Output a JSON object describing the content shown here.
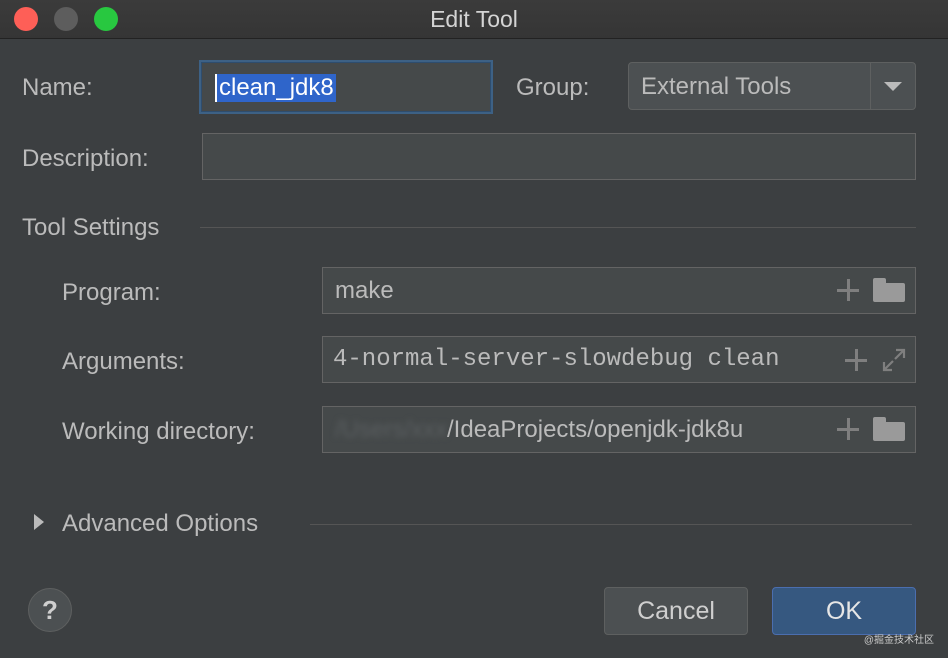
{
  "window": {
    "title": "Edit Tool"
  },
  "form": {
    "name_label": "Name:",
    "name_value": "clean_jdk8",
    "group_label": "Group:",
    "group_value": "External Tools",
    "description_label": "Description:",
    "description_value": ""
  },
  "tool_settings": {
    "section_title": "Tool Settings",
    "program_label": "Program:",
    "program_value": "make",
    "arguments_label": "Arguments:",
    "arguments_value": "4-normal-server-slowdebug clean",
    "working_dir_label": "Working directory:",
    "working_dir_obscured": "/Users/xxx",
    "working_dir_value": "/IdeaProjects/openjdk-jdk8u"
  },
  "advanced": {
    "section_title": "Advanced Options"
  },
  "buttons": {
    "help": "?",
    "cancel": "Cancel",
    "ok": "OK"
  },
  "watermark": "@掘金技术社区",
  "icons": [
    "add-icon",
    "folder-icon",
    "expand-icon",
    "chevron-right-icon",
    "help-icon",
    "dropdown-arrow-icon"
  ],
  "colors": {
    "background": "#3c3f41",
    "selection": "#2f65ca",
    "ok_button": "#365880"
  }
}
